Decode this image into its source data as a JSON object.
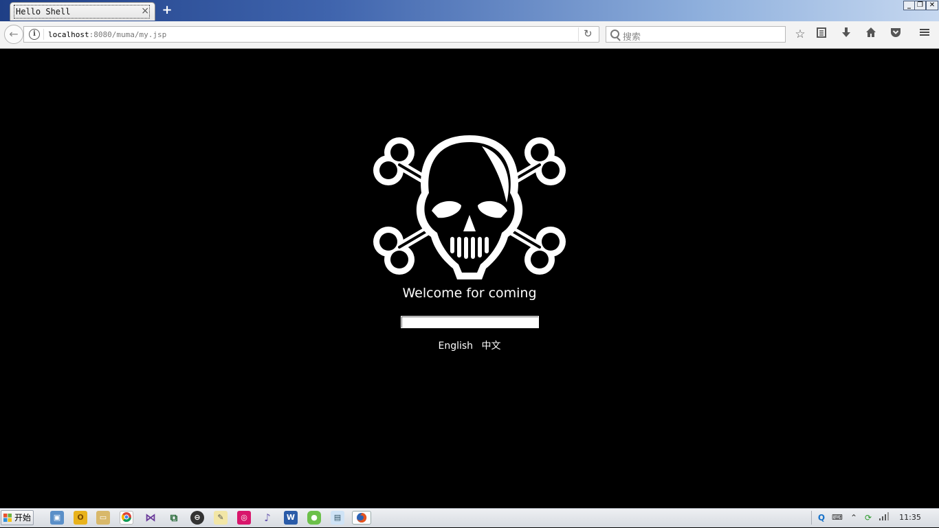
{
  "browser": {
    "tab": {
      "title": "Hello Shell",
      "close": "×"
    },
    "new_tab": "+",
    "window_controls": [
      "_",
      "❐",
      "✕"
    ],
    "url": {
      "host": "localhost",
      "path": ":8080/muma/my.jsp"
    },
    "search": {
      "placeholder": "搜索"
    },
    "toolbar_icons": [
      "star-icon",
      "reading-list-icon",
      "download-icon",
      "home-icon",
      "pocket-icon",
      "menu-icon"
    ]
  },
  "page": {
    "welcome": "Welcome for coming",
    "input_value": "",
    "languages": {
      "english": "English",
      "chinese": "中文"
    }
  },
  "taskbar": {
    "start_label": "开始",
    "clock": "11:35",
    "colors": {
      "chrome": "#3b88d4",
      "vs": "#6a3a9a",
      "word": "#2a5ba8",
      "firefox": "#e6541f"
    }
  }
}
